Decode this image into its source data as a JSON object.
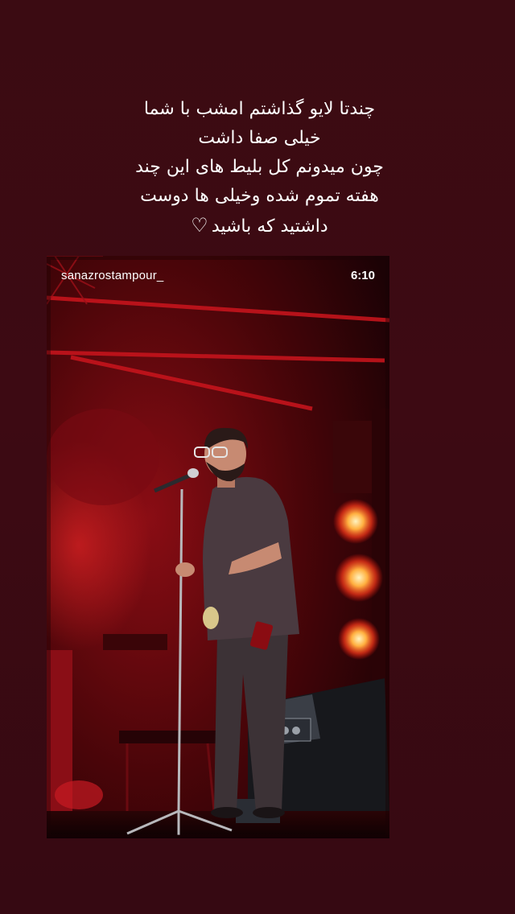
{
  "caption": {
    "lines": [
      "چندتا لایو گذاشتم امشب با شما",
      "خیلی صفا داشت",
      "چون میدونم کل بلیط های این چند",
      "هفته تموم شده وخیلی ها دوست",
      "داشتید که باشید"
    ],
    "heart_icon": "white-heart-icon"
  },
  "video": {
    "username": "sanazrostampour_",
    "time": "6:10"
  },
  "colors": {
    "background": "#3b0b12",
    "stage_red": "#d4141e",
    "light_glow": "#ff6a2a"
  }
}
